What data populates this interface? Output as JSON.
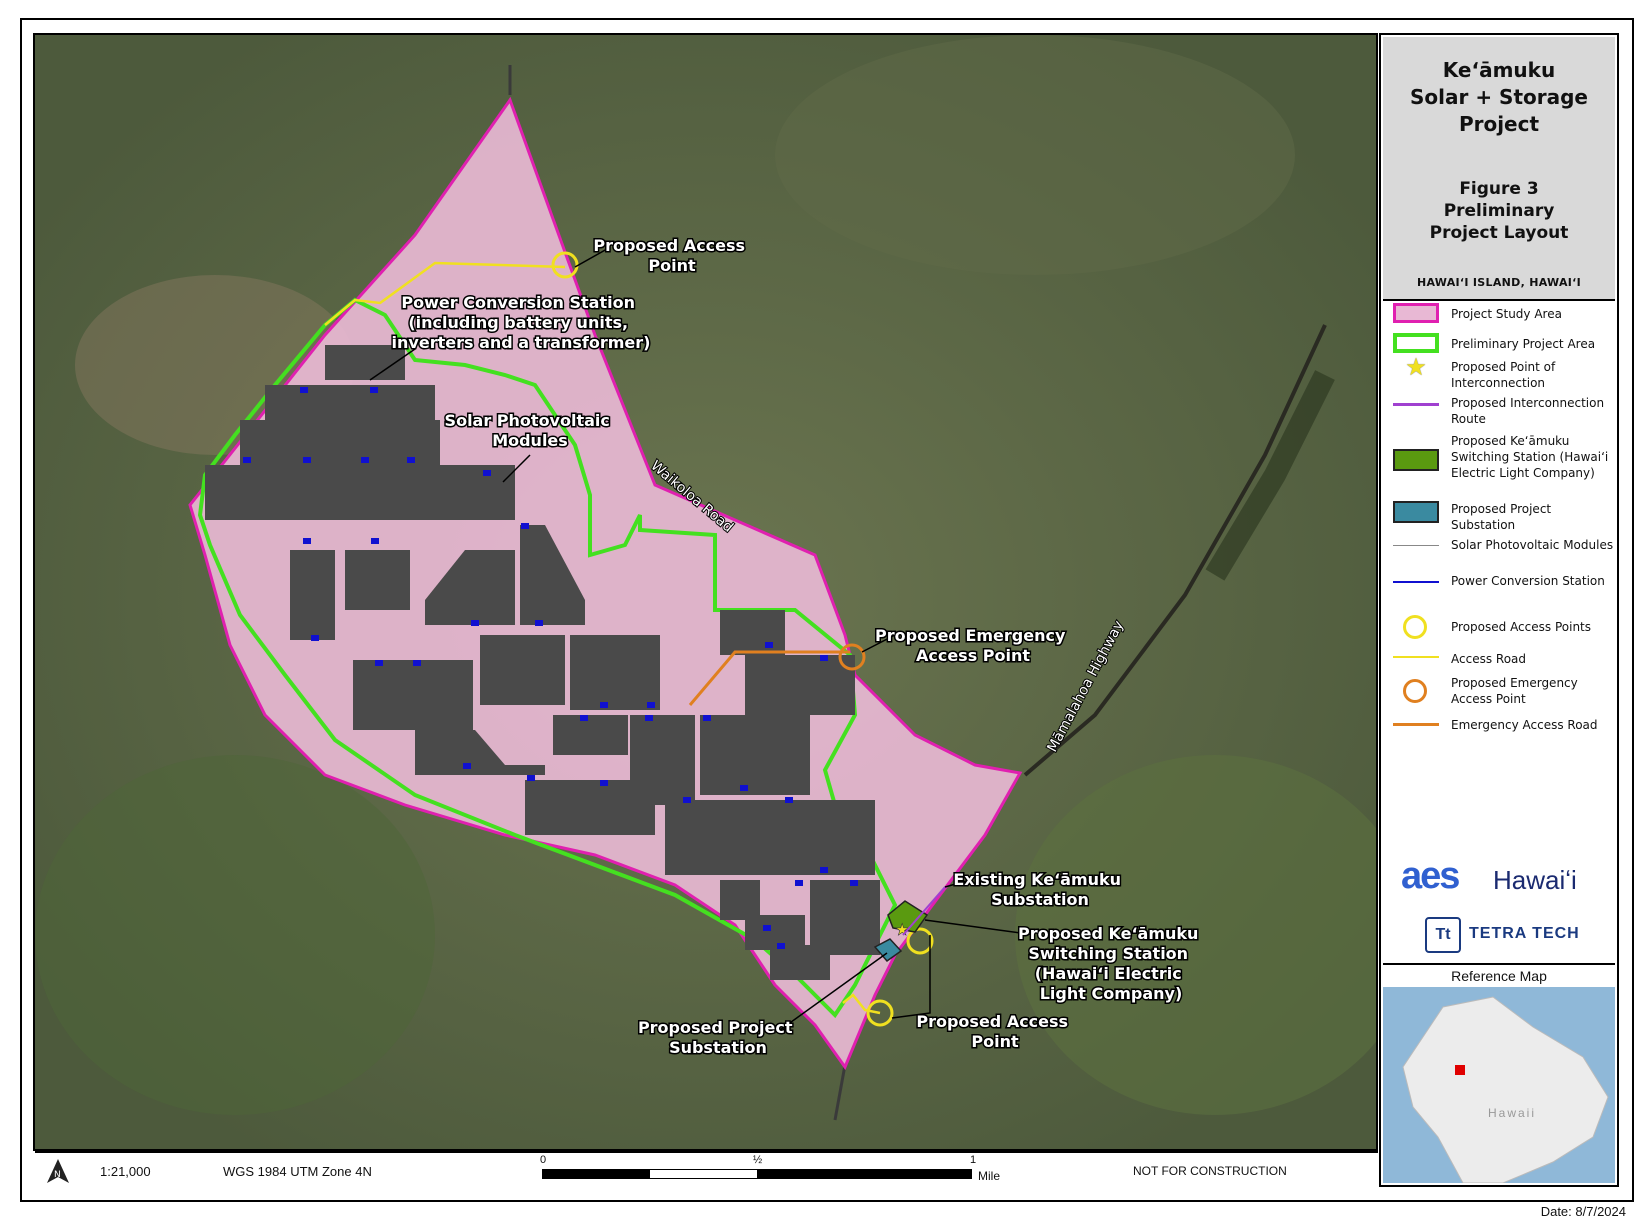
{
  "title": {
    "project": [
      "Keʻāmuku",
      "Solar + Storage",
      "Project"
    ],
    "figure": [
      "Figure 3",
      "Preliminary",
      "Project Layout"
    ],
    "location": "HAWAIʻI ISLAND, HAWAIʻI"
  },
  "legend": [
    {
      "icon": "pink-polygon",
      "label": "Project Study Area"
    },
    {
      "icon": "green-outline-polygon",
      "label": "Preliminary Project Area"
    },
    {
      "icon": "yellow-star-icon",
      "label": "Proposed Point of Interconnection"
    },
    {
      "icon": "purple-line",
      "label": "Proposed Interconnection Route"
    },
    {
      "icon": "olive-polygon",
      "label": "Proposed Keʻāmuku Switching Station (Hawaiʻi Electric Light Company)"
    },
    {
      "icon": "teal-polygon",
      "label": "Proposed Project Substation"
    },
    {
      "icon": "gray-line",
      "label": "Solar Photovoltaic Modules"
    },
    {
      "icon": "blue-line",
      "label": "Power Conversion Station"
    },
    {
      "icon": "yellow-circle",
      "label": "Proposed Access Points"
    },
    {
      "icon": "yellow-line",
      "label": "Access Road"
    },
    {
      "icon": "orange-circle",
      "label": "Proposed Emergency Access Point"
    },
    {
      "icon": "orange-line",
      "label": "Emergency Access Road"
    }
  ],
  "logos": {
    "aes": "aes",
    "aes_suffix": "Hawaiʻi",
    "tetra": "TETRA TECH",
    "tetra_mark": "Tt"
  },
  "reference_map": {
    "title": "Reference Map",
    "island_label": "Hawaii"
  },
  "map_labels": {
    "access_point_north": [
      "Proposed Access",
      "Point"
    ],
    "pcs": [
      "Power Conversion Station",
      "(including battery units,",
      "inverters and a transformer)"
    ],
    "pv": [
      "Solar Photovoltaic",
      "Modules"
    ],
    "waikoloa_road": "Waikoloa Road",
    "emergency_access": [
      "Proposed Emergency",
      "Access Point"
    ],
    "highway": "Māmalahoa Highway",
    "existing_substation": [
      "Existing Keʻāmuku",
      "Substation"
    ],
    "switching_station": [
      "Proposed Keʻāmuku",
      "Switching Station",
      "(Hawaiʻi Electric",
      "Light Company)"
    ],
    "access_point_south": [
      "Proposed Access",
      "Point"
    ],
    "project_substation": [
      "Proposed Project",
      "Substation"
    ]
  },
  "footer": {
    "scale": "1:21,000",
    "crs": "WGS 1984 UTM Zone 4N",
    "scalebar_ticks": [
      "0",
      "½",
      "1"
    ],
    "scalebar_unit": "Mile",
    "note": "NOT FOR CONSTRUCTION",
    "north_label": "N"
  },
  "date": "Date: 8/7/2024",
  "colors": {
    "study_area_fill": "#e8b8d4",
    "study_area_stroke": "#e020b0",
    "project_area_stroke": "#44e020",
    "pv_modules": "#4a4a4a",
    "pcs": "#1010d0",
    "access": "#f0e020",
    "emergency": "#e08020",
    "switching_station": "#5a9a10",
    "project_substation": "#3a8aa0",
    "interconnection_route": "#a040d0"
  }
}
